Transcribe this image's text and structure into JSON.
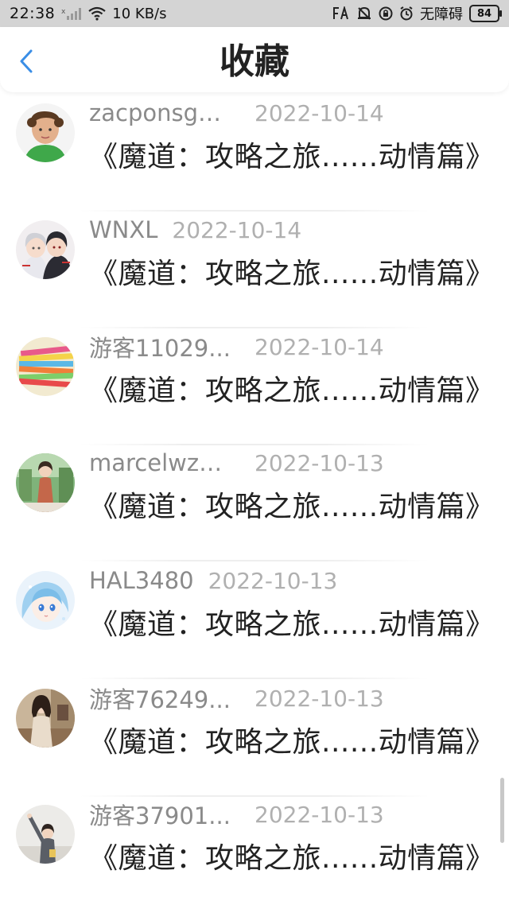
{
  "status_bar": {
    "time": "22:38",
    "speed": "10 KB/s",
    "dnd_text": "无障碍",
    "battery": "84",
    "icons": [
      "signal-x-icon",
      "signal-bars-icon",
      "wifi-icon",
      "fa-icon",
      "notification-off-icon",
      "vpn-icon",
      "alarm-icon",
      "battery-icon"
    ]
  },
  "header": {
    "back_icon": "chevron-left-icon",
    "title": "收藏",
    "accent_color": "#3a8ee6"
  },
  "items": [
    {
      "username": "zacponsge...",
      "date": "2022-10-14",
      "title": "《魔道：攻略之旅......动情篇》",
      "avatar": "boy-green-shirt"
    },
    {
      "username": "WNXL",
      "date": "2022-10-14",
      "title": "《魔道：攻略之旅......动情篇》",
      "avatar": "anime-couple"
    },
    {
      "username": "游客11029...",
      "date": "2022-10-14",
      "title": "《魔道：攻略之旅......动情篇》",
      "avatar": "color-stack"
    },
    {
      "username": "marcelwzo...",
      "date": "2022-10-13",
      "title": "《魔道：攻略之旅......动情篇》",
      "avatar": "girl-garden"
    },
    {
      "username": "HAL3480",
      "date": "2022-10-13",
      "title": "《魔道：攻略之旅......动情篇》",
      "avatar": "anime-blue-hair"
    },
    {
      "username": "游客76249...",
      "date": "2022-10-13",
      "title": "《魔道：攻略之旅......动情篇》",
      "avatar": "woman-cafe"
    },
    {
      "username": "游客37901...",
      "date": "2022-10-13",
      "title": "《魔道：攻略之旅......动情篇》",
      "avatar": "person-waving"
    }
  ]
}
